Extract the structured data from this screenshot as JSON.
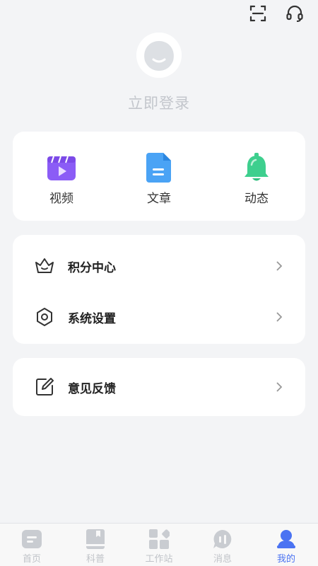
{
  "header": {
    "scan_icon": "scan-icon",
    "service_icon": "headset-icon"
  },
  "profile": {
    "login_text": "立即登录"
  },
  "quick_actions": [
    {
      "label": "视频",
      "icon": "video-icon",
      "color": "#8b5cf6"
    },
    {
      "label": "文章",
      "icon": "document-icon",
      "color": "#4aa3f5"
    },
    {
      "label": "动态",
      "icon": "bell-icon",
      "color": "#3ecf8e"
    }
  ],
  "menu": {
    "items": [
      {
        "label": "积分中心",
        "icon": "crown-icon"
      },
      {
        "label": "系统设置",
        "icon": "settings-icon"
      },
      {
        "label": "意见反馈",
        "icon": "feedback-icon"
      }
    ]
  },
  "tabbar": {
    "items": [
      {
        "label": "首页",
        "icon": "home-icon",
        "active": false
      },
      {
        "label": "科普",
        "icon": "book-icon",
        "active": false
      },
      {
        "label": "工作站",
        "icon": "grid-icon",
        "active": false
      },
      {
        "label": "消息",
        "icon": "message-icon",
        "active": false
      },
      {
        "label": "我的",
        "icon": "user-icon",
        "active": true
      }
    ],
    "active_color": "#4b73f2",
    "inactive_color": "#c0c3c8"
  }
}
